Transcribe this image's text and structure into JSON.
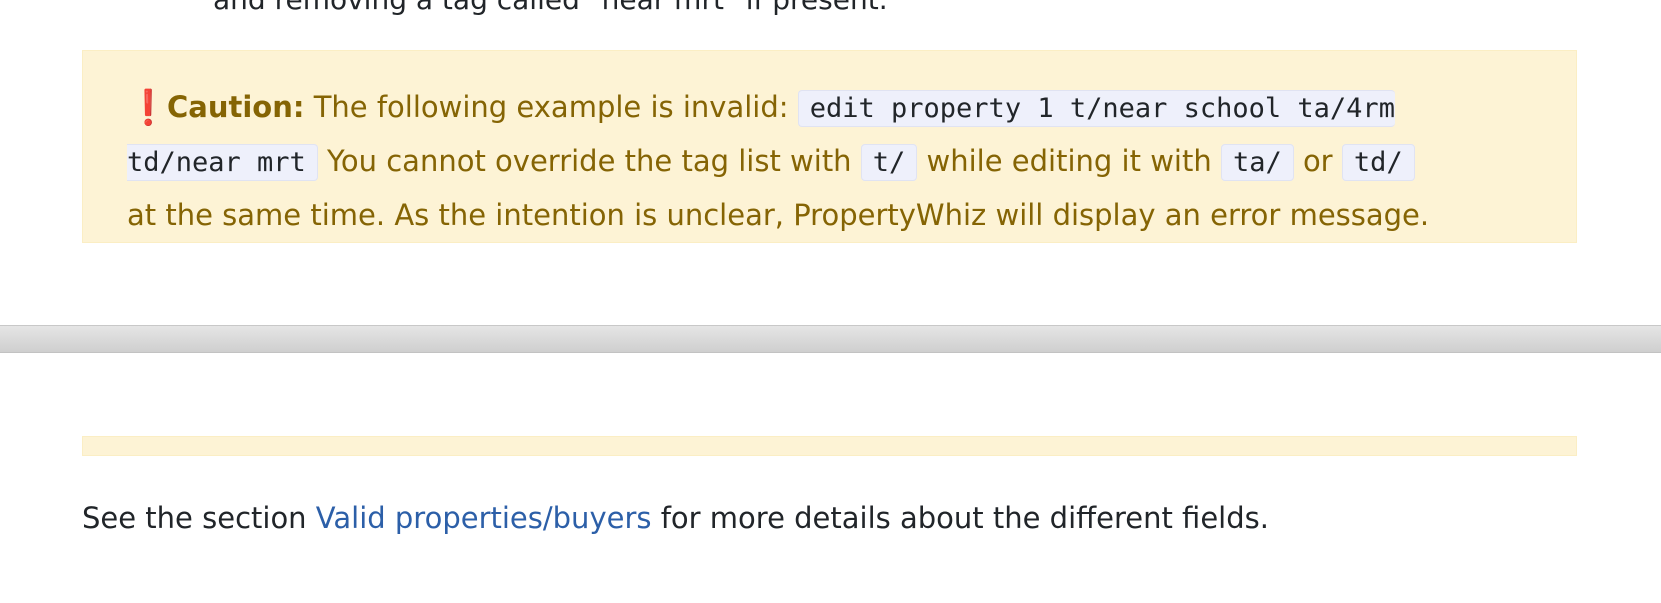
{
  "top_text": "and removing a tag called \"near mrt\" if present.",
  "caution": {
    "icon": "exclamation-icon",
    "icon_glyph": "❗",
    "label": "Caution:",
    "intro": "The following example is invalid:",
    "example_command_line1": "edit property 1 t/near school ta/4rm",
    "example_command_line2": "td/near mrt",
    "text_1": "You cannot override the tag list with",
    "code_1": "t/",
    "text_2": "while editing it with",
    "code_2": "ta/",
    "text_3": "or",
    "code_3": "td/",
    "text_4": "at the same time. As the intention is unclear, PropertyWhiz will display an error message."
  },
  "footer": {
    "prefix": "See the section",
    "link_label": "Valid properties/buyers",
    "suffix": "for more details about the different fields."
  },
  "colors": {
    "callout_bg": "#fdf3d5",
    "callout_text": "#856404",
    "icon": "#dc3545",
    "link": "#2c5fa8"
  }
}
